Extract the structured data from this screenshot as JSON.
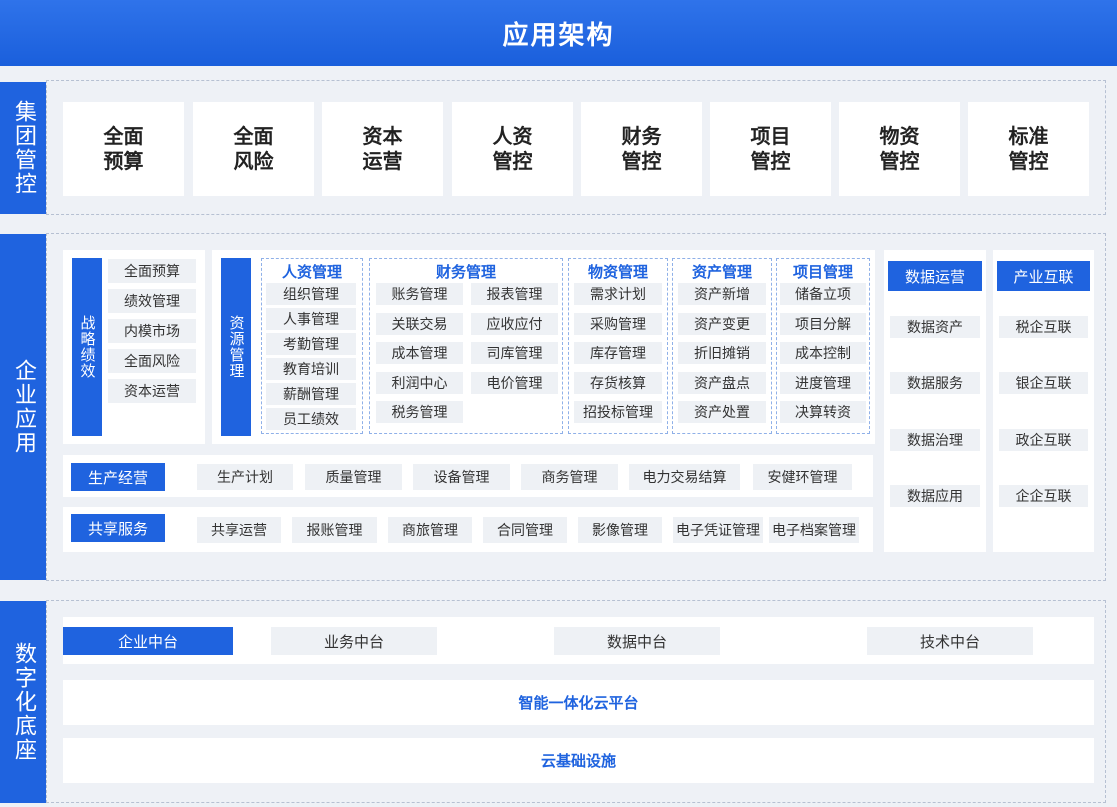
{
  "title": "应用架构",
  "sections": {
    "group": {
      "label": "集团管控",
      "cards": [
        "全面\n预算",
        "全面\n风险",
        "资本\n运营",
        "人资\n管控",
        "财务\n管控",
        "项目\n管控",
        "物资\n管控",
        "标准\n管控"
      ]
    },
    "enterprise": {
      "label": "企业应用",
      "strategy": {
        "label": "战略绩效",
        "items": [
          "全面预算",
          "绩效管理",
          "内模市场",
          "全面风险",
          "资本运营"
        ]
      },
      "resource_label": "资源管理",
      "hr": {
        "title": "人资管理",
        "items": [
          "组织管理",
          "人事管理",
          "考勤管理",
          "教育培训",
          "薪酬管理",
          "员工绩效"
        ]
      },
      "finance": {
        "title": "财务管理",
        "items": [
          "账务管理",
          "报表管理",
          "关联交易",
          "应收应付",
          "成本管理",
          "司库管理",
          "利润中心",
          "电价管理",
          "税务管理"
        ]
      },
      "material": {
        "title": "物资管理",
        "items": [
          "需求计划",
          "采购管理",
          "库存管理",
          "存货核算",
          "招投标管理"
        ]
      },
      "asset": {
        "title": "资产管理",
        "items": [
          "资产新增",
          "资产变更",
          "折旧摊销",
          "资产盘点",
          "资产处置"
        ]
      },
      "project": {
        "title": "项目管理",
        "items": [
          "储备立项",
          "项目分解",
          "成本控制",
          "进度管理",
          "决算转资"
        ]
      },
      "production": {
        "label": "生产经营",
        "items": [
          "生产计划",
          "质量管理",
          "设备管理",
          "商务管理",
          "电力交易结算",
          "安健环管理"
        ]
      },
      "shared": {
        "label": "共享服务",
        "items": [
          "共享运营",
          "报账管理",
          "商旅管理",
          "合同管理",
          "影像管理",
          "电子凭证管理",
          "电子档案管理"
        ]
      },
      "data_ops": {
        "title": "数据运营",
        "items": [
          "数据资产",
          "数据服务",
          "数据治理",
          "数据应用"
        ]
      },
      "industry": {
        "title": "产业互联",
        "items": [
          "税企互联",
          "银企互联",
          "政企互联",
          "企企互联"
        ]
      }
    },
    "digital": {
      "label": "数字化底座",
      "platforms": [
        "企业中台",
        "业务中台",
        "数据中台",
        "技术中台"
      ],
      "cloud": "智能一体化云平台",
      "infra": "云基础设施"
    }
  },
  "colors": {
    "primary": "#1f63df",
    "item_bg": "#eef1f5",
    "page_bg": "#eef1f6"
  }
}
